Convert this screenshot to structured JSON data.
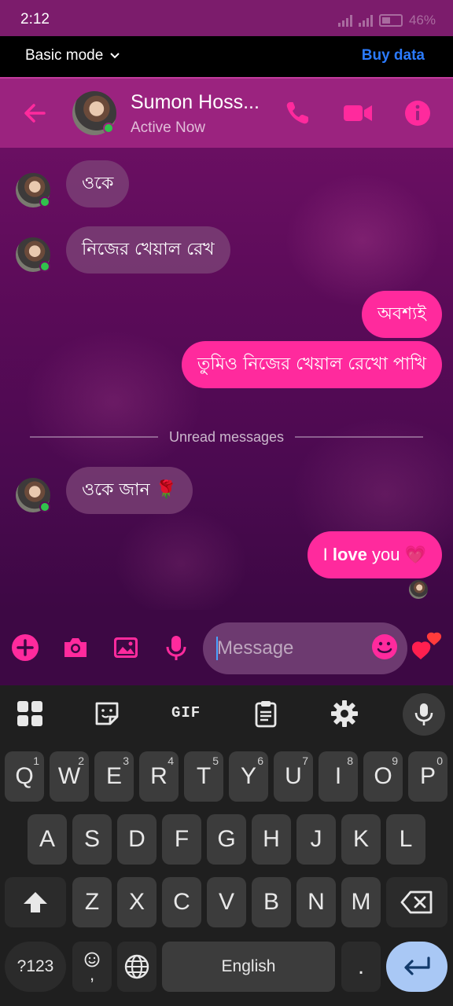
{
  "status_bar": {
    "time": "2:12",
    "battery": "46%"
  },
  "top_banner": {
    "mode_label": "Basic mode",
    "buy_label": "Buy data"
  },
  "header": {
    "name": "Sumon Hoss...",
    "status": "Active Now"
  },
  "messages": [
    {
      "direction": "in",
      "text": "ওকে"
    },
    {
      "direction": "in",
      "text": "নিজের খেয়াল রেখ"
    },
    {
      "direction": "out",
      "text": "অবশ্যই"
    },
    {
      "direction": "out",
      "text": "তুমিও নিজের খেয়াল রেখো পাখি"
    },
    {
      "direction": "in",
      "text": "ওকে জান 🌹"
    },
    {
      "direction": "out",
      "text_prefix": "I ",
      "text_bold": "love",
      "text_suffix": " you 💗"
    }
  ],
  "divider": {
    "label": "Unread messages"
  },
  "composer": {
    "placeholder": "Message"
  },
  "keyboard": {
    "toolbar": [
      "apps-grid",
      "sticker",
      "GIF",
      "clipboard",
      "settings",
      "voice"
    ],
    "gif_label": "GIF",
    "row1": [
      {
        "k": "Q",
        "h": "1"
      },
      {
        "k": "W",
        "h": "2"
      },
      {
        "k": "E",
        "h": "3"
      },
      {
        "k": "R",
        "h": "4"
      },
      {
        "k": "T",
        "h": "5"
      },
      {
        "k": "Y",
        "h": "6"
      },
      {
        "k": "U",
        "h": "7"
      },
      {
        "k": "I",
        "h": "8"
      },
      {
        "k": "O",
        "h": "9"
      },
      {
        "k": "P",
        "h": "0"
      }
    ],
    "row2": [
      "A",
      "S",
      "D",
      "F",
      "G",
      "H",
      "J",
      "K",
      "L"
    ],
    "row3": [
      "Z",
      "X",
      "C",
      "V",
      "B",
      "N",
      "M"
    ],
    "symbols_label": "?123",
    "comma_label": ",",
    "space_label": "English",
    "period_label": "."
  },
  "colors": {
    "accent": "#ff2a9d",
    "header_bg": "#9b237f",
    "link_blue": "#2b7bff",
    "online": "#31c24c"
  }
}
